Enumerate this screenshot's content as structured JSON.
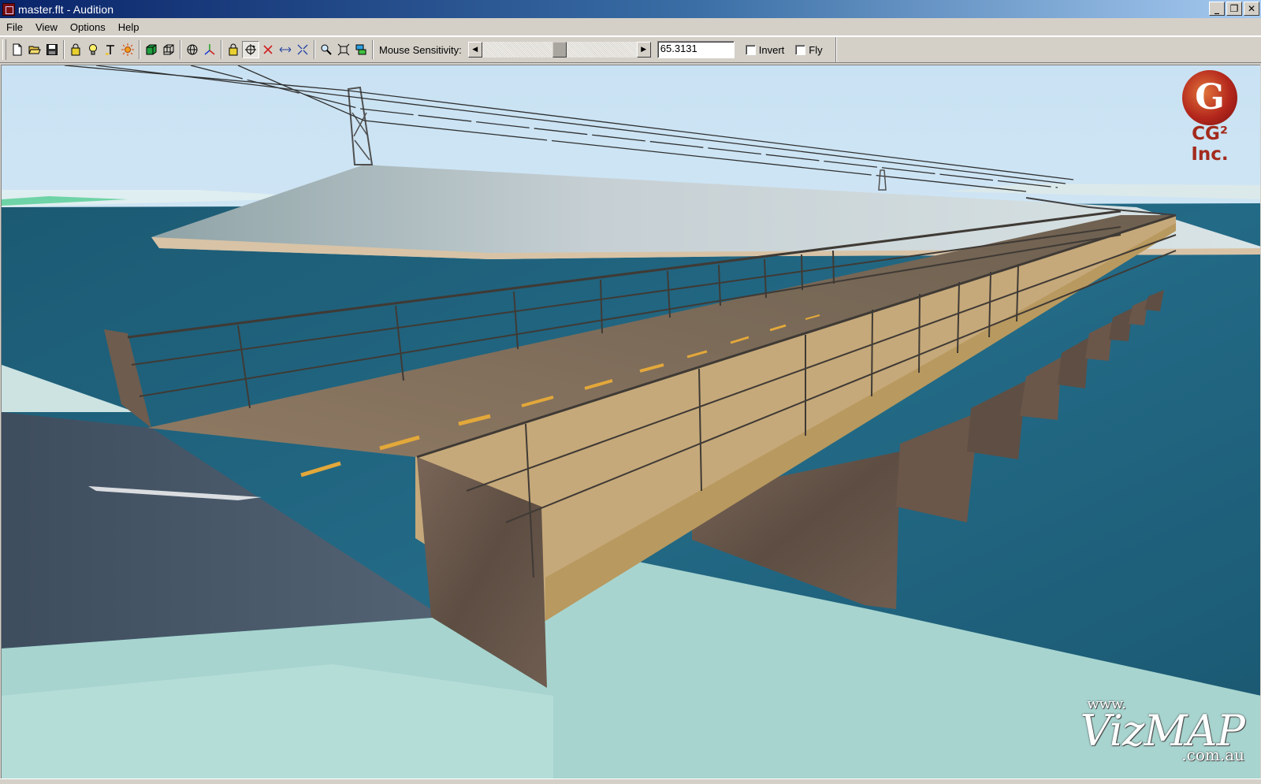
{
  "window": {
    "title": "master.flt - Audition",
    "icon": "audition-app-icon",
    "buttons": {
      "minimize": "_",
      "restore": "❐",
      "close": "✕"
    }
  },
  "menu": [
    {
      "label": "File"
    },
    {
      "label": "View"
    },
    {
      "label": "Options"
    },
    {
      "label": "Help"
    }
  ],
  "toolbar": {
    "groups": [
      [
        "new-file-icon",
        "open-folder-icon",
        "save-disk-icon"
      ],
      [
        "lock-icon",
        "light-bulb-icon",
        "text-tool-icon",
        "sun-light-icon"
      ],
      [
        "solid-cube-icon",
        "wireframe-cube-icon"
      ],
      [
        "globe-icon",
        "axes-icon"
      ],
      [
        "lock-icon",
        "rotate-view-icon",
        "delete-icon",
        "pan-icon",
        "collapse-icon"
      ],
      [
        "zoom-icon",
        "fit-view-icon",
        "layers-icon"
      ]
    ],
    "mouse_sensitivity_label": "Mouse Sensitivity:",
    "sensitivity_level": 0.5,
    "sensitivity_value": "65.3131",
    "invert_label": "Invert",
    "invert_checked": false,
    "fly_label": "Fly",
    "fly_checked": false
  },
  "viewport": {
    "logo_mark": "G",
    "logo_text": "CG² Inc.",
    "watermark_www": "www.",
    "watermark_main": "VizMAP",
    "watermark_domain": ".com.au"
  },
  "colors": {
    "titlebar_start": "#0a246a",
    "titlebar_end": "#a6caf0",
    "sky": "#cfe6f5",
    "water": "#1f5f78",
    "land": "#a9d6d0",
    "bridge_deck": "#7a6a58",
    "pier": "#6b5a4c",
    "lane_marking": "#e0a83a"
  }
}
